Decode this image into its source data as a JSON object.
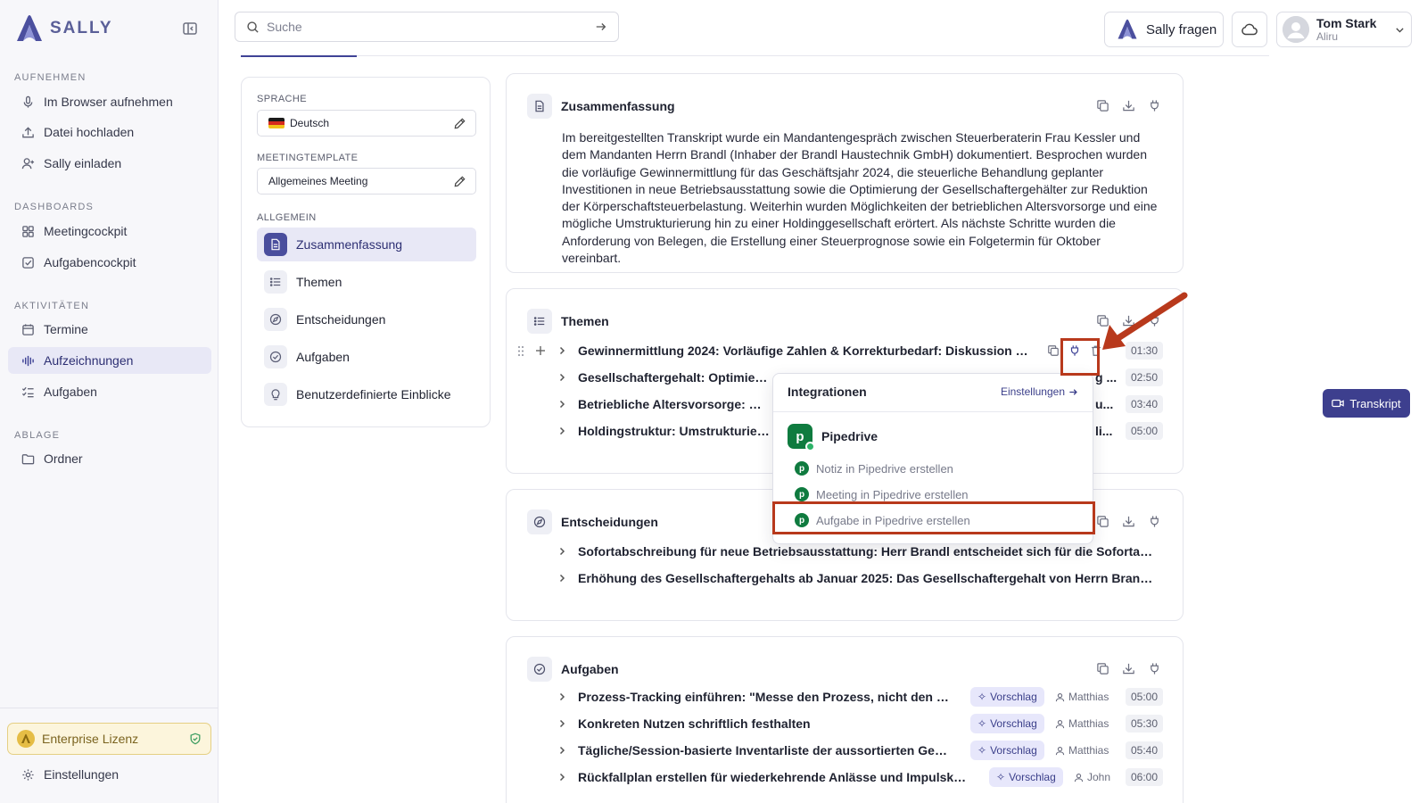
{
  "brand": {
    "name": "SALLY"
  },
  "sidebar": {
    "sections": [
      {
        "title": "AUFNEHMEN",
        "items": [
          {
            "label": "Im Browser aufnehmen",
            "icon": "mic-icon"
          },
          {
            "label": "Datei hochladen",
            "icon": "upload-icon"
          },
          {
            "label": "Sally einladen",
            "icon": "user-plus-icon"
          }
        ]
      },
      {
        "title": "DASHBOARDS",
        "items": [
          {
            "label": "Meetingcockpit",
            "icon": "grid-icon"
          },
          {
            "label": "Aufgabencockpit",
            "icon": "checkbox-icon"
          }
        ]
      },
      {
        "title": "AKTIVITÄTEN",
        "items": [
          {
            "label": "Termine",
            "icon": "calendar-icon"
          },
          {
            "label": "Aufzeichnungen",
            "icon": "waveform-icon",
            "active": true
          },
          {
            "label": "Aufgaben",
            "icon": "checklist-icon"
          }
        ]
      },
      {
        "title": "ABLAGE",
        "items": [
          {
            "label": "Ordner",
            "icon": "folder-icon"
          }
        ]
      }
    ],
    "license": "Enterprise Lizenz",
    "settings": "Einstellungen"
  },
  "topbar": {
    "search_placeholder": "Suche",
    "ask_label": "Sally fragen",
    "user_name": "Tom Stark",
    "user_org": "Aliru"
  },
  "left_panel": {
    "language_label": "SPRACHE",
    "language_value": "Deutsch",
    "template_label": "MEETINGTEMPLATE",
    "template_value": "Allgemeines Meeting",
    "general_label": "ALLGEMEIN",
    "items": [
      {
        "label": "Zusammenfassung",
        "active": true
      },
      {
        "label": "Themen"
      },
      {
        "label": "Entscheidungen"
      },
      {
        "label": "Aufgaben"
      },
      {
        "label": "Benutzerdefinierte Einblicke"
      }
    ]
  },
  "summary": {
    "title": "Zusammenfassung",
    "text": "Im bereitgestellten Transkript wurde ein Mandantengespräch zwischen Steuerberaterin Frau Kessler und dem Mandanten Herrn Brandl (Inhaber der Brandl Haustechnik GmbH) dokumentiert. Besprochen wurden die vorläufige Gewinnermittlung für das Geschäftsjahr 2024, die steuerliche Behandlung geplanter Investitionen in neue Betriebsausstattung sowie die Optimierung der Gesellschaftergehälter zur Reduktion der Körperschaftsteuerbelastung. Weiterhin wurden Möglichkeiten der betrieblichen Altersvorsorge und eine mögliche Umstrukturierung hin zu einer Holdinggesellschaft erörtert. Als nächste Schritte wurden die Anforderung von Belegen, die Erstellung einer Steuerprognose sowie ein Folgetermin für Oktober vereinbart."
  },
  "topics": {
    "title": "Themen",
    "rows": [
      {
        "text": "Gewinnermittlung 2024: Vorläufige Zahlen & Korrekturbedarf: Diskussion abw...",
        "time": "01:30"
      },
      {
        "text": "Gesellschaftergehalt: Optimierung",
        "tail": "g ...",
        "time": "02:50"
      },
      {
        "text": "Betriebliche Altersvorsorge: Direkt",
        "tail": "u...",
        "time": "03:40"
      },
      {
        "text": "Holdingstruktur: Umstrukturierun",
        "tail": "li...",
        "time": "05:00"
      }
    ]
  },
  "decisions": {
    "title": "Entscheidungen",
    "rows": [
      {
        "text": "Sofortabschreibung für neue Betriebsausstattung: Herr Brandl entscheidet sich für die Sofortabsch..."
      },
      {
        "text": "Erhöhung des Gesellschaftergehalts ab Januar 2025: Das Gesellschaftergehalt von Herrn Brandl wir..."
      }
    ]
  },
  "tasks": {
    "title": "Aufgaben",
    "rows": [
      {
        "text": "Prozess-Tracking einführen: \"Messe den Prozess, nicht den Zusta...",
        "badge": "Vorschlag",
        "assignee": "Matthias",
        "time": "05:00"
      },
      {
        "text": "Konkreten Nutzen schriftlich festhalten",
        "badge": "Vorschlag",
        "assignee": "Matthias",
        "time": "05:30"
      },
      {
        "text": "Tägliche/Session-basierte Inventarliste der aussortierten Gegens...",
        "badge": "Vorschlag",
        "assignee": "Matthias",
        "time": "05:40"
      },
      {
        "text": "Rückfallplan erstellen für wiederkehrende Anlässe und Impulskäufe",
        "badge": "Vorschlag",
        "assignee": "John",
        "time": "06:00"
      }
    ]
  },
  "integrations": {
    "title": "Integrationen",
    "settings": "Einstellungen",
    "app": "Pipedrive",
    "options": [
      "Notiz in Pipedrive erstellen",
      "Meeting in Pipedrive erstellen",
      "Aufgabe in Pipedrive erstellen"
    ]
  },
  "transkript_button": "Transkript",
  "colors": {
    "accent": "#3f4396",
    "highlight": "#b8391c",
    "pipedrive": "#0f7b3f"
  }
}
